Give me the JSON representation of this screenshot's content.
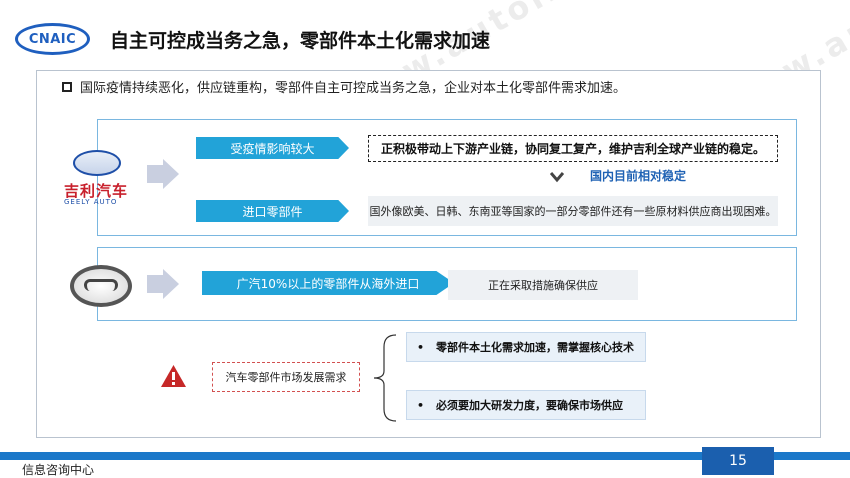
{
  "header": {
    "logo_text": "CNAIC",
    "title": "自主可控成当务之急，零部件本土化需求加速"
  },
  "intro": "国际疫情持续恶化，供应链重构，零部件自主可控成当务之急，企业对本土化零部件需求加速。",
  "geely": {
    "logo_cn": "吉利汽车",
    "logo_en": "GEELY AUTO",
    "tag1": "受疫情影响较大",
    "tag1_text": "正积极带动上下游产业链，协同复工复产，维护吉利全球产业链的稳定。",
    "domestic": "国内目前相对稳定",
    "tag2": "进口零部件",
    "tag2_text": "国外像欧美、日韩、东南亚等国家的一部分零部件还有一些原材料供应商出现困难。"
  },
  "gac": {
    "tag": "广汽10%以上的零部件从海外进口",
    "text": "正在采取措施确保供应"
  },
  "market": {
    "label": "汽车零部件市场发展需求",
    "items": [
      "零部件本土化需求加速，需掌握核心技术",
      "必须要加大研发力度，要确保市场供应"
    ]
  },
  "footer": {
    "org": "信息咨询中心",
    "page": "15"
  },
  "watermark": "中国汽车工业信息网 www.autoinfo.org.cn",
  "colors": {
    "tag_blue": "#22a3d8",
    "footer_blue": "#1b78c9",
    "stable_blue": "#1f62b4",
    "warning_red": "#c62828"
  }
}
